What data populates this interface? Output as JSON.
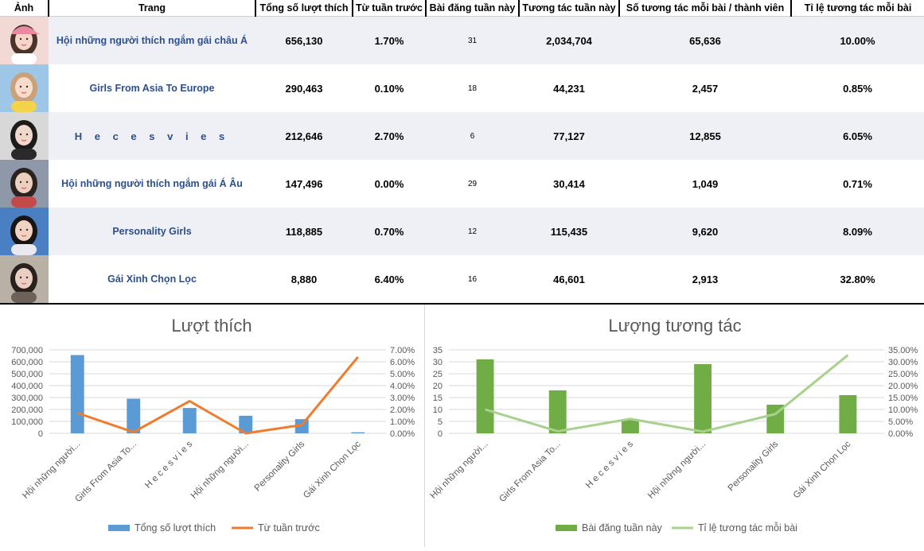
{
  "table": {
    "headers": [
      "Ảnh",
      "Trang",
      "Tổng số lượt thích",
      "Từ tuần trước",
      "Bài đăng tuần này",
      "Tương tác tuần này",
      "Số tương tác mỗi bài / thành viên",
      "Tỉ lệ tương tác mỗi bài"
    ],
    "rows": [
      {
        "page": "Hội những người thích ngắm gái châu Á",
        "likes": "656,130",
        "change": "1.70%",
        "posts": "31",
        "interactions": "2,034,704",
        "per_post": "65,636",
        "rate": "10.00%"
      },
      {
        "page": "Girls From Asia To Europe",
        "likes": "290,463",
        "change": "0.10%",
        "posts": "18",
        "interactions": "44,231",
        "per_post": "2,457",
        "rate": "0.85%"
      },
      {
        "page": "H e c e s v i e s",
        "likes": "212,646",
        "change": "2.70%",
        "posts": "6",
        "interactions": "77,127",
        "per_post": "12,855",
        "rate": "6.05%"
      },
      {
        "page": "Hội những người thích ngắm gái Á Âu",
        "likes": "147,496",
        "change": "0.00%",
        "posts": "29",
        "interactions": "30,414",
        "per_post": "1,049",
        "rate": "0.71%"
      },
      {
        "page": "Personality Girls",
        "likes": "118,885",
        "change": "0.70%",
        "posts": "12",
        "interactions": "115,435",
        "per_post": "9,620",
        "rate": "8.09%"
      },
      {
        "page": "Gái Xinh Chọn Lọc",
        "likes": "8,880",
        "change": "6.40%",
        "posts": "16",
        "interactions": "46,601",
        "per_post": "2,913",
        "rate": "32.80%"
      }
    ]
  },
  "chart_data": [
    {
      "type": "bar",
      "title": "Lượt thích",
      "categories": [
        "Hội những người...",
        "Girls From Asia To...",
        "H e c e s v i e s",
        "Hội những người...",
        "Personality Girls",
        "Gái Xinh Chọn Lọc"
      ],
      "y_ticks": [
        "0",
        "100,000",
        "200,000",
        "300,000",
        "400,000",
        "500,000",
        "600,000",
        "700,000"
      ],
      "y2_ticks": [
        "0.00%",
        "1.00%",
        "2.00%",
        "3.00%",
        "4.00%",
        "5.00%",
        "6.00%",
        "7.00%"
      ],
      "ylim": [
        0,
        700000
      ],
      "y2lim": [
        0,
        7
      ],
      "series": [
        {
          "name": "Tổng số lượt thích",
          "kind": "bar",
          "axis": "primary",
          "color": "#5b9bd5",
          "values": [
            656130,
            290463,
            212646,
            147496,
            118885,
            8880
          ]
        },
        {
          "name": "Từ tuần trước",
          "kind": "line",
          "axis": "secondary",
          "color": "#ed7d31",
          "values": [
            1.7,
            0.1,
            2.7,
            0.0,
            0.7,
            6.4
          ]
        }
      ],
      "legend": "bottom",
      "grid": true
    },
    {
      "type": "bar",
      "title": "Lượng tương tác",
      "categories": [
        "Hội những người...",
        "Girls From Asia To...",
        "H e c e s v i e s",
        "Hội những người...",
        "Personality Girls",
        "Gái Xinh Chọn Lọc"
      ],
      "y_ticks": [
        "0",
        "5",
        "10",
        "15",
        "20",
        "25",
        "30",
        "35"
      ],
      "y2_ticks": [
        "0.00%",
        "5.00%",
        "10.00%",
        "15.00%",
        "20.00%",
        "25.00%",
        "30.00%",
        "35.00%"
      ],
      "ylim": [
        0,
        35
      ],
      "y2lim": [
        0,
        35
      ],
      "series": [
        {
          "name": "Bài đăng tuần này",
          "kind": "bar",
          "axis": "primary",
          "color": "#70ad47",
          "values": [
            31,
            18,
            6,
            29,
            12,
            16
          ]
        },
        {
          "name": "Tỉ lệ tương tác mỗi bài",
          "kind": "line",
          "axis": "secondary",
          "color": "#a9d18e",
          "values": [
            10.0,
            0.85,
            6.05,
            0.71,
            8.09,
            32.8
          ]
        }
      ],
      "legend": "bottom",
      "grid": true
    }
  ],
  "colors": {
    "header_bg": "#ffffff",
    "row_alt": "#eef0f5",
    "page_link": "#2e4f8a"
  },
  "thumbnails": [
    "woman-pink-cap-photo",
    "woman-yellow-flowers-photo",
    "woman-dark-hair-photo",
    "woman-street-photo",
    "woman-sky-photo",
    "woman-indoor-photo"
  ]
}
